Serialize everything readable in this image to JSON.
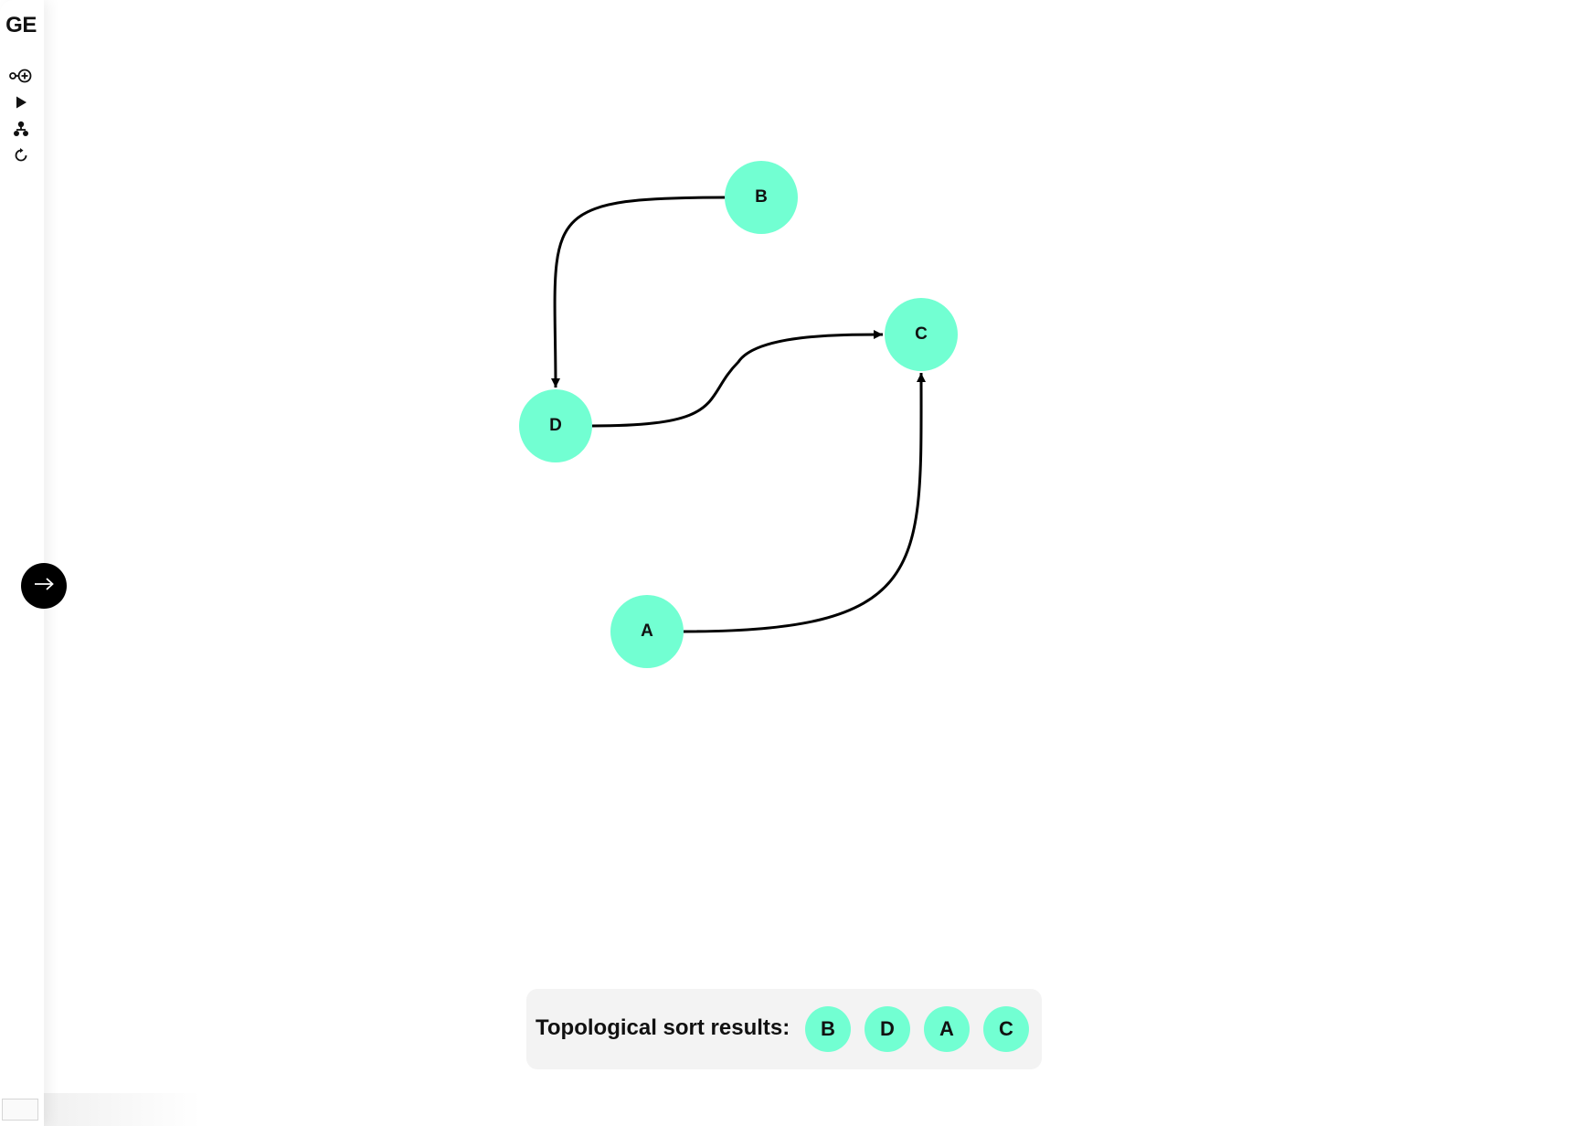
{
  "theme": {
    "node_color": "#72ffd2",
    "edge_color": "#000000",
    "text_color": "#111111"
  },
  "sidebar": {
    "logo": "GE",
    "tools": [
      {
        "name": "add-node-tool",
        "icon": "add-node-icon"
      },
      {
        "name": "run-tool",
        "icon": "play-icon"
      },
      {
        "name": "tree-layout-tool",
        "icon": "hierarchy-icon"
      },
      {
        "name": "reset-tool",
        "icon": "refresh-icon"
      }
    ],
    "toggle_icon": "arrow-right-icon"
  },
  "graph": {
    "nodes": [
      {
        "id": "B",
        "label": "B"
      },
      {
        "id": "C",
        "label": "C"
      },
      {
        "id": "D",
        "label": "D"
      },
      {
        "id": "A",
        "label": "A"
      }
    ],
    "edges": [
      {
        "from": "B",
        "to": "D"
      },
      {
        "from": "D",
        "to": "C"
      },
      {
        "from": "A",
        "to": "C"
      }
    ]
  },
  "results": {
    "label": "Topological sort results:",
    "order": [
      "B",
      "D",
      "A",
      "C"
    ]
  }
}
